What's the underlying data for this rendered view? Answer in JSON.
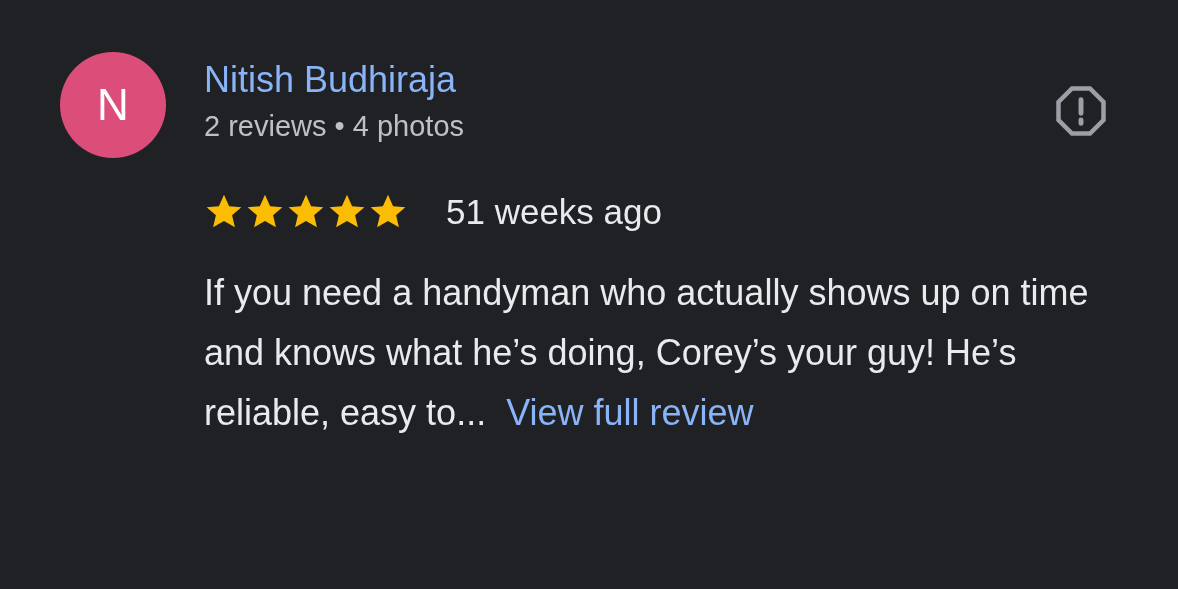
{
  "review": {
    "avatar_letter": "N",
    "author": "Nitish Budhiraja",
    "author_meta": "2 reviews • 4 photos",
    "stars": 5,
    "time": "51 weeks ago",
    "text": "If you need a handyman who actually shows up on time and knows what he’s doing, Corey’s your guy! He’s reliable, easy to...",
    "more_link": "View full review"
  }
}
